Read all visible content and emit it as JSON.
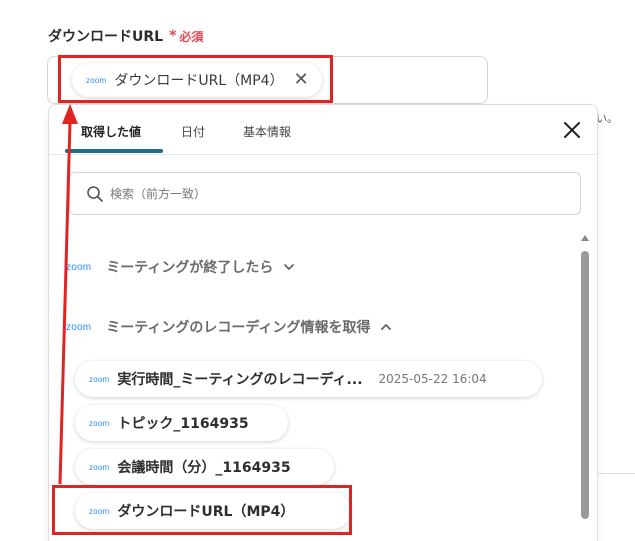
{
  "field": {
    "label": "ダウンロードURL",
    "required_star": "*",
    "required_text": "必須"
  },
  "selected_chip": {
    "logo": "zoom",
    "text": "ダウンロードURL（MP4）",
    "close_glyph": "✕"
  },
  "side_text": "い。",
  "panel": {
    "tabs": [
      "取得した値",
      "日付",
      "基本情報"
    ],
    "active_tab": "取得した値",
    "close_icon": "close-icon",
    "search_placeholder": "検索（前方一致）",
    "sections": [
      {
        "logo": "zoom",
        "title": "ミーティングが終了したら",
        "state": "collapsed"
      },
      {
        "logo": "zoom",
        "title": "ミーティングのレコーディング情報を取得",
        "state": "expanded"
      }
    ],
    "items": [
      {
        "logo": "zoom",
        "label": "実行時間_ミーティングのレコーディ...",
        "value": "2025-05-22 16:04"
      },
      {
        "logo": "zoom",
        "label": "トピック_1164935"
      },
      {
        "logo": "zoom",
        "label": "会議時間（分）_1164935"
      },
      {
        "logo": "zoom",
        "label": "ダウンロードURL（MP4）"
      }
    ]
  },
  "colors": {
    "accent": "#1e6f8c",
    "required": "#e5484d",
    "zoom_blue": "#2d8cff",
    "annotation_red": "#e02424"
  }
}
